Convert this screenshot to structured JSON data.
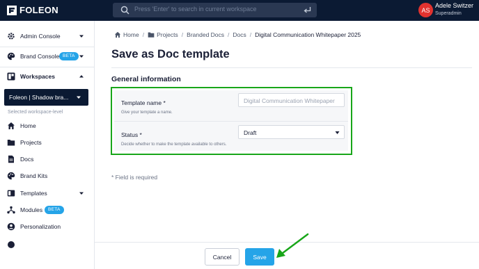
{
  "app": {
    "logo_text": "FOLEON"
  },
  "search": {
    "placeholder": "Press 'Enter' to search in current workspace"
  },
  "user": {
    "initials": "AS",
    "name": "Adele Switzer",
    "role": "Superadmin"
  },
  "sidebar": {
    "admin_console": "Admin Console",
    "brand_console": "Brand Console",
    "brand_console_badge": "BETA",
    "workspaces": "Workspaces",
    "workspace_selected": "Foleon | Shadow bra...",
    "workspace_level": "Selected workspace-level",
    "items": [
      {
        "label": "Home",
        "icon": "home-icon"
      },
      {
        "label": "Projects",
        "icon": "folder-icon"
      },
      {
        "label": "Docs",
        "icon": "document-icon"
      },
      {
        "label": "Brand Kits",
        "icon": "palette-icon"
      },
      {
        "label": "Templates",
        "icon": "template-icon"
      },
      {
        "label": "Modules",
        "icon": "modules-icon",
        "badge": "BETA"
      },
      {
        "label": "Personalization",
        "icon": "user-circle-icon"
      }
    ]
  },
  "breadcrumb": {
    "home": "Home",
    "projects": "Projects",
    "branded_docs": "Branded Docs",
    "docs": "Docs",
    "current": "Digital Communication Whitepaper 2025",
    "separator": "/"
  },
  "page": {
    "title": "Save as Doc template",
    "section_title": "General information"
  },
  "form": {
    "template_name_label": "Template name *",
    "template_name_help": "Give your template a name.",
    "template_name_value": "Digital Communication Whitepaper",
    "status_label": "Status *",
    "status_help": "Decide whether to make the template available to others.",
    "status_value": "Draft"
  },
  "required_note": "* Field is required",
  "footer": {
    "cancel_label": "Cancel",
    "save_label": "Save"
  },
  "colors": {
    "topbar": "#0b1a33",
    "accent": "#25a4e8",
    "highlight": "#18a619",
    "avatar": "#e0322f"
  }
}
